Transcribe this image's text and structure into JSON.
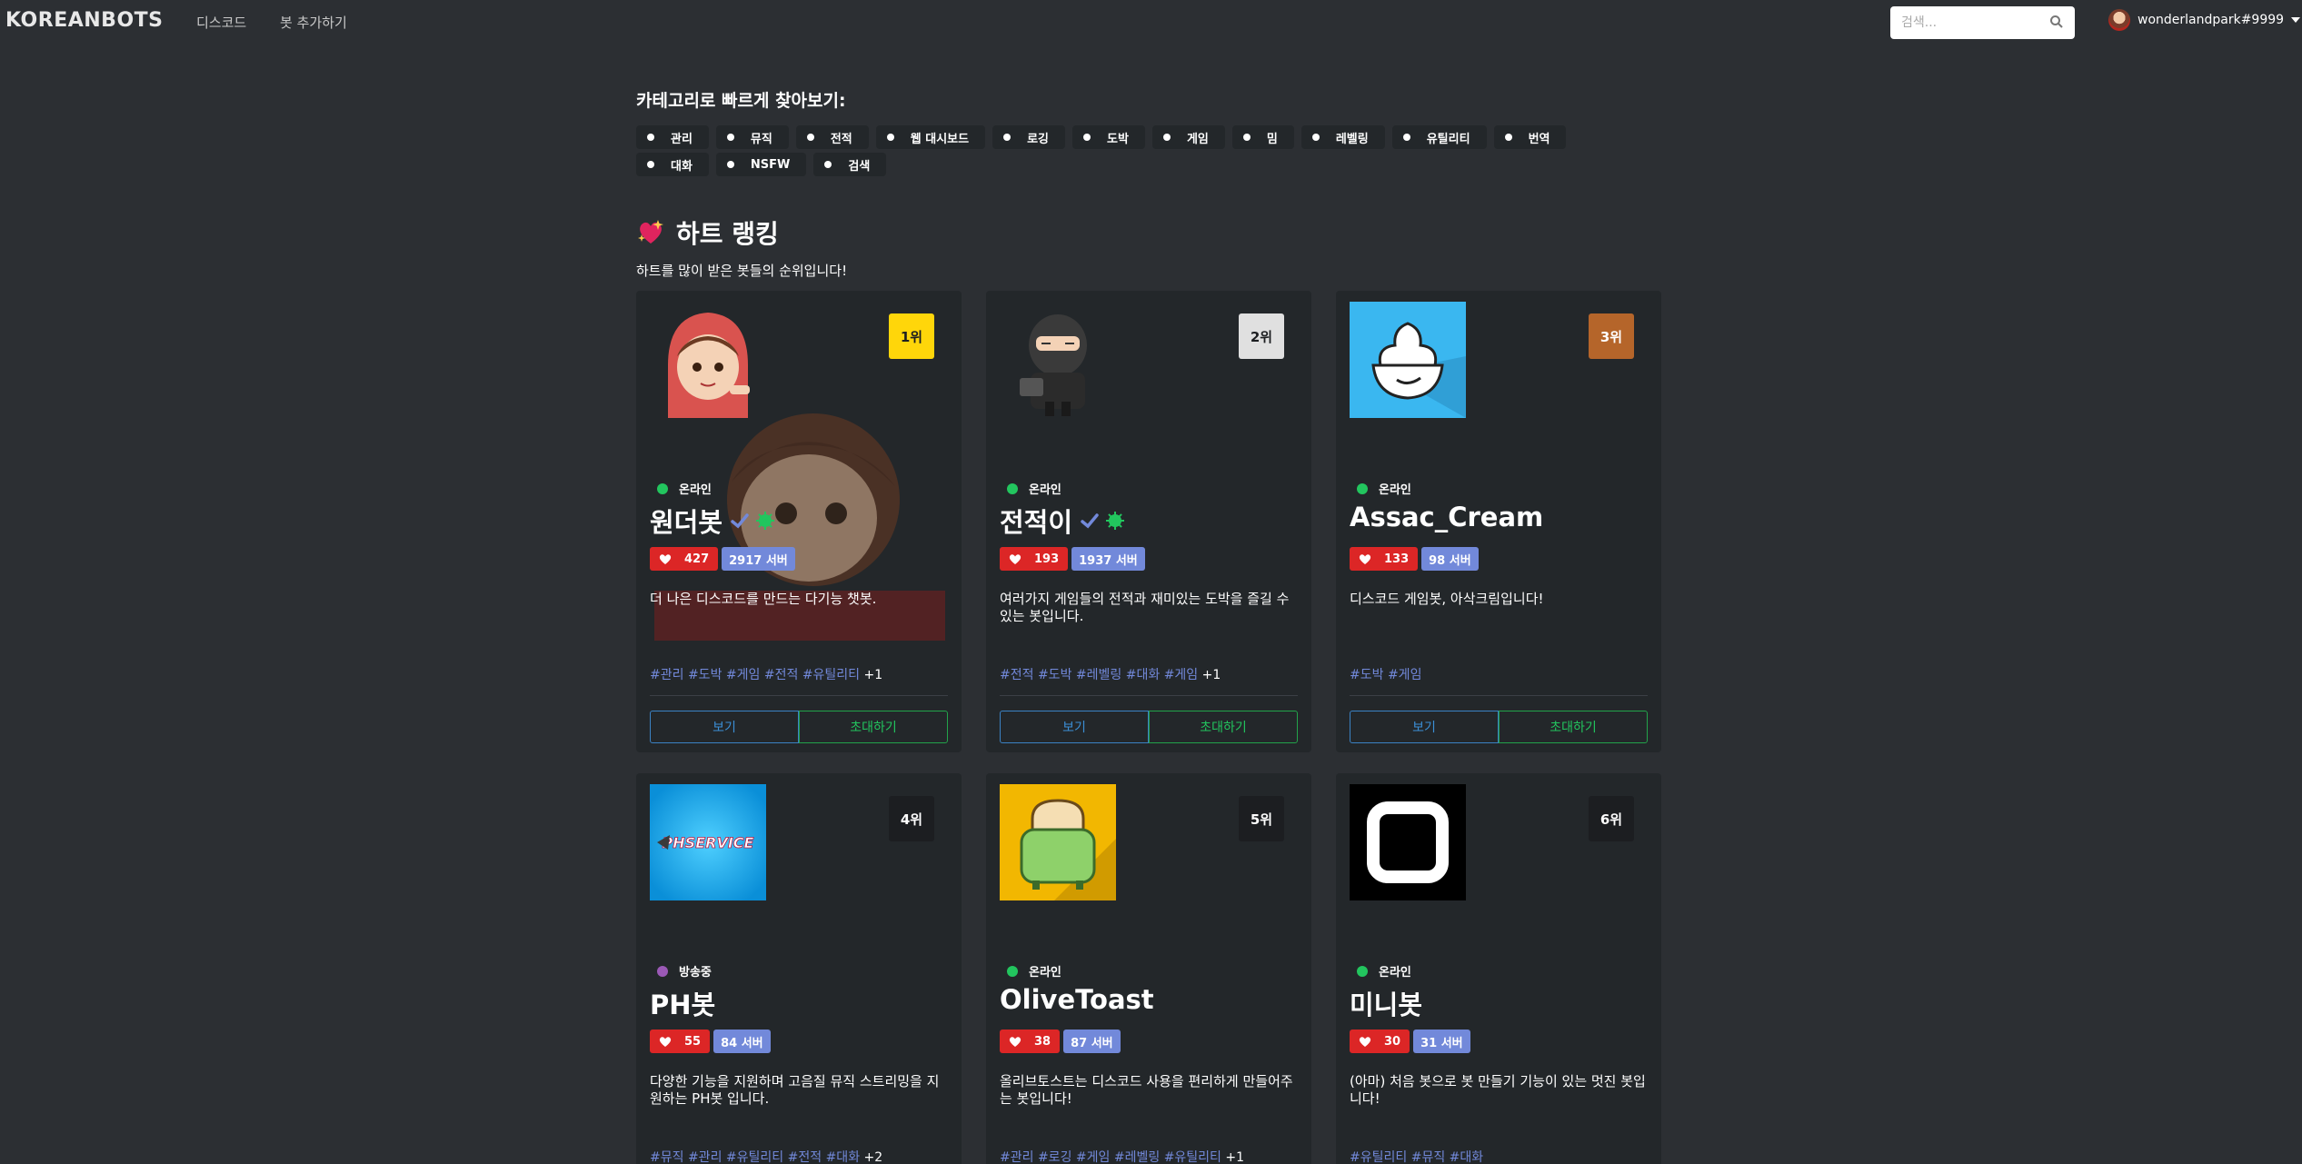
{
  "nav": {
    "brand": "KOREANBOTS",
    "links": [
      "디스코드",
      "봇 추가하기"
    ],
    "search_placeholder": "검색...",
    "username": "wonderlandpark#9999"
  },
  "categories": {
    "title": "카테고리로 빠르게 찾아보기:",
    "items": [
      "관리",
      "뮤직",
      "전적",
      "웹 대시보드",
      "로깅",
      "도박",
      "게임",
      "밈",
      "레벨링",
      "유틸리티",
      "번역",
      "대화",
      "NSFW",
      "검색"
    ]
  },
  "section": {
    "title": "하트 랭킹",
    "description": "하트를 많이 받은 봇들의 순위입니다!"
  },
  "colors": {
    "rank1": "#ffd60a",
    "rank2": "#e0e0e0",
    "rank3": "#b5652a",
    "rank_other": "#1c1e21",
    "online": "#22c55e",
    "streaming": "#9b59b6",
    "heart": "#dc2626",
    "server": "#7289da"
  },
  "bots": [
    {
      "rank": "1위",
      "status": "온라인",
      "name": "원더봇",
      "hearts": "427",
      "servers": "2917 서버",
      "description": "더 나은 디스코드를 만드는 다기능 챗봇.",
      "tags": [
        "#관리",
        "#도박",
        "#게임",
        "#전적",
        "#유틸리티"
      ],
      "more": "+1",
      "view": "보기",
      "invite": "초대하기"
    },
    {
      "rank": "2위",
      "status": "온라인",
      "name": "전적이",
      "hearts": "193",
      "servers": "1937 서버",
      "description": "여러가지 게임들의 전적과 재미있는 도박을 즐길 수 있는 봇입니다.",
      "tags": [
        "#전적",
        "#도박",
        "#레벨링",
        "#대화",
        "#게임"
      ],
      "more": "+1",
      "view": "보기",
      "invite": "초대하기"
    },
    {
      "rank": "3위",
      "status": "온라인",
      "name": "Assac_Cream",
      "hearts": "133",
      "servers": "98 서버",
      "description": "디스코드 게임봇, 아삭크림입니다!",
      "tags": [
        "#도박",
        "#게임"
      ],
      "more": "",
      "view": "보기",
      "invite": "초대하기"
    },
    {
      "rank": "4위",
      "status": "방송중",
      "name": "PH봇",
      "hearts": "55",
      "servers": "84 서버",
      "description": "다양한 기능을 지원하며 고음질 뮤직 스트리밍을 지원하는 PH봇 입니다.",
      "tags": [
        "#뮤직",
        "#관리",
        "#유틸리티",
        "#전적",
        "#대화"
      ],
      "more": "+2",
      "avatar_text": "PHSERVICE"
    },
    {
      "rank": "5위",
      "status": "온라인",
      "name": "OliveToast",
      "hearts": "38",
      "servers": "87 서버",
      "description": "올리브토스트는 디스코드 사용을 편리하게 만들어주는 봇입니다!",
      "tags": [
        "#관리",
        "#로깅",
        "#게임",
        "#레벨링",
        "#유틸리티"
      ],
      "more": "+1"
    },
    {
      "rank": "6위",
      "status": "온라인",
      "name": "미니봇",
      "hearts": "30",
      "servers": "31 서버",
      "description": "(아마) 처음 봇으로 봇 만들기 기능이 있는 멋진 봇입니다!",
      "tags": [
        "#유틸리티",
        "#뮤직",
        "#대화"
      ],
      "more": ""
    }
  ]
}
